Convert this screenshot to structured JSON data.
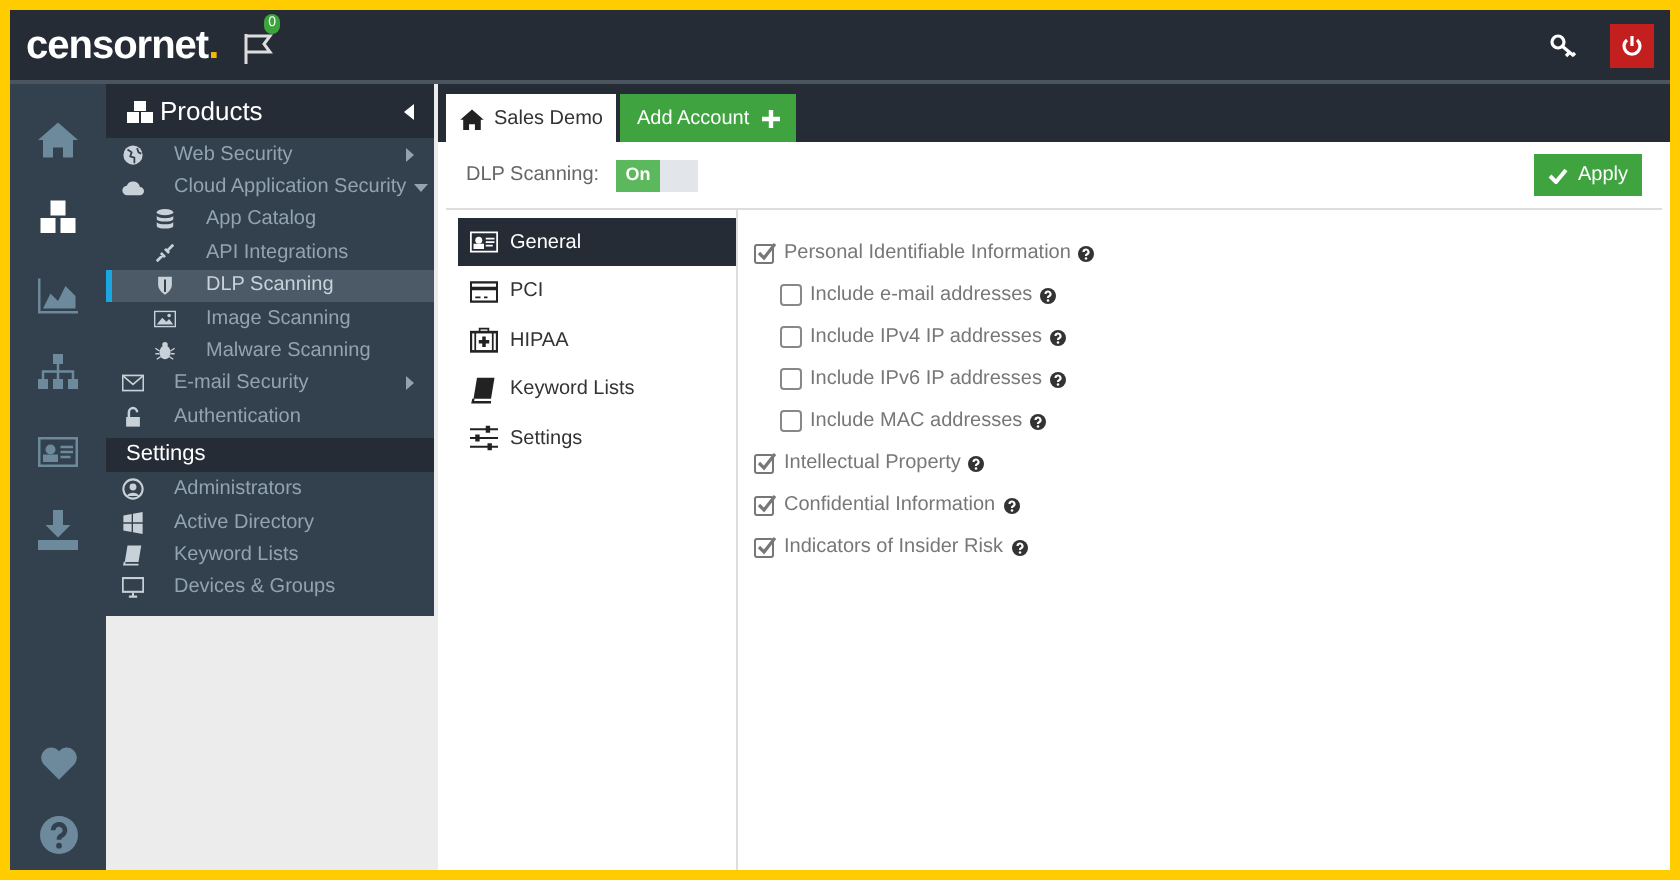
{
  "header": {
    "logo_name": "censornet",
    "logo_dot": ".",
    "flag_badge": "0"
  },
  "rail": [
    {
      "selected": false
    },
    {
      "selected": true
    },
    {
      "selected": false
    },
    {
      "selected": false
    },
    {
      "selected": false
    },
    {
      "selected": false
    }
  ],
  "menu": {
    "title": "Products",
    "items": [
      {
        "label": "Web Security",
        "expanded": false,
        "selected": false
      },
      {
        "label": "Cloud Application Security",
        "expanded": true,
        "selected": false,
        "children": [
          {
            "label": "App Catalog",
            "selected": false
          },
          {
            "label": "API Integrations",
            "selected": false
          },
          {
            "label": "DLP Scanning",
            "selected": true
          },
          {
            "label": "Image Scanning",
            "selected": false
          },
          {
            "label": "Malware Scanning",
            "selected": false
          }
        ]
      },
      {
        "label": "E-mail Security",
        "expanded": false,
        "selected": false
      },
      {
        "label": "Authentication",
        "selected": false
      }
    ],
    "settings_title": "Settings",
    "settings": [
      {
        "label": "Administrators",
        "selected": false
      },
      {
        "label": "Active Directory",
        "selected": false
      },
      {
        "label": "Keyword Lists",
        "selected": false
      },
      {
        "label": "Devices & Groups",
        "selected": false
      }
    ]
  },
  "account_tab": {
    "label": "Sales Demo"
  },
  "add_account": "Add Account",
  "dlp": {
    "label": "DLP Scanning:",
    "toggle_text": "On",
    "on": true
  },
  "apply": "Apply",
  "subnav": [
    {
      "label": "General",
      "selected": true
    },
    {
      "label": "PCI",
      "selected": false
    },
    {
      "label": "HIPAA",
      "selected": false
    },
    {
      "label": "Keyword Lists",
      "selected": false
    },
    {
      "label": "Settings",
      "selected": false
    }
  ],
  "options": [
    {
      "label": "Personal Identifiable Information",
      "checked": true,
      "children": [
        {
          "label": "Include e-mail addresses",
          "checked": false
        },
        {
          "label": "Include IPv4 IP addresses",
          "checked": false
        },
        {
          "label": "Include IPv6 IP addresses",
          "checked": false
        },
        {
          "label": "Include MAC addresses",
          "checked": false
        }
      ]
    },
    {
      "label": "Intellectual Property",
      "checked": true
    },
    {
      "label": "Confidential Information",
      "checked": true
    },
    {
      "label": "Indicators of Insider Risk",
      "checked": true
    }
  ]
}
